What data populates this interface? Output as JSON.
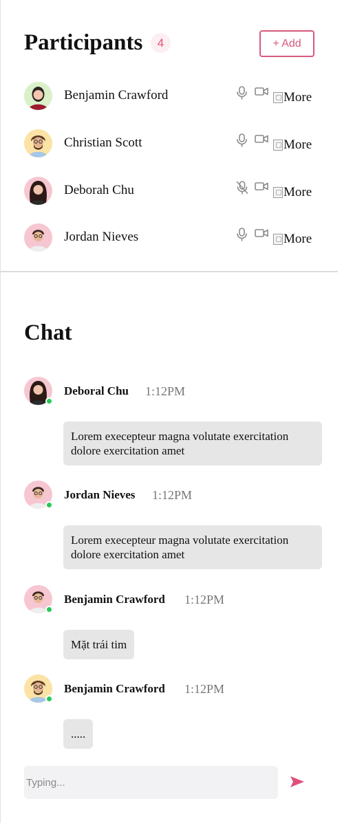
{
  "participants": {
    "title": "Participants",
    "count": "4",
    "add_label": "+ Add",
    "more_alt": "More",
    "list": [
      {
        "name": "Benjamin Crawford",
        "mic": "on",
        "avatar_bg": "#d9f0c9",
        "hair": "#2e2420",
        "shirt": "#9b1b30",
        "skin": "#f1c7ad"
      },
      {
        "name": "Christian Scott",
        "mic": "on",
        "avatar_bg": "#fbe3a6",
        "hair": "#5a3c22",
        "shirt": "#a7c7e6",
        "skin": "#e3b48f"
      },
      {
        "name": "Deborah Chu",
        "mic": "muted",
        "avatar_bg": "#f6c6d1",
        "hair": "#2b1a16",
        "shirt": "#2b2b2b",
        "skin": "#f0c3ac"
      },
      {
        "name": "Jordan Nieves",
        "mic": "on",
        "avatar_bg": "#f6c6d1",
        "hair": "#3a2a22",
        "shirt": "#eeeeee",
        "skin": "#e7b796"
      }
    ]
  },
  "chat": {
    "title": "Chat",
    "messages": [
      {
        "sender": "Deboral Chu",
        "time": "1:12PM",
        "text": "Lorem execepteur magna volutate exercitation dolore exercitation amet"
      },
      {
        "sender": "Jordan Nieves",
        "time": "1:12PM",
        "text": "Lorem execepteur magna volutate exercitation dolore exercitation amet"
      },
      {
        "sender": "Benjamin Crawford",
        "time": "1:12PM",
        "text": "Mặt trái tim"
      },
      {
        "sender": "Benjamin Crawford",
        "time": "1:12PM",
        "text": "....."
      }
    ],
    "input_placeholder": "Typing..."
  },
  "colors": {
    "accent": "#d65a7c",
    "online": "#26c85a",
    "bubble": "#e6e6e6",
    "icon": "#8a8a8a"
  },
  "icons": [
    "microphone-icon",
    "microphone-muted-icon",
    "video-camera-icon",
    "more-icon",
    "send-icon"
  ]
}
